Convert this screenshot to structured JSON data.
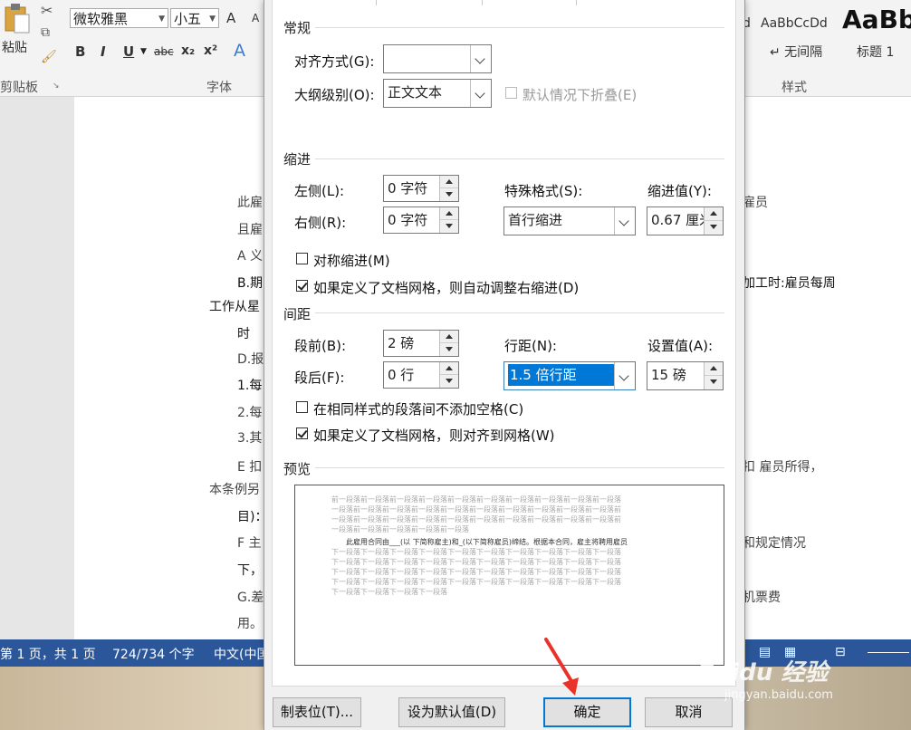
{
  "ribbon": {
    "paste_label": "粘贴",
    "font_name": "微软雅黑",
    "font_size": "小五",
    "grow_label": "A",
    "shrink_label": "A",
    "bold": "B",
    "italic": "I",
    "underline": "U",
    "strike": "abc",
    "subscript": "x₂",
    "superscript": "x²",
    "clipboard_label": "剪贴板",
    "font_group_label": "字体",
    "styles_group_label": "样式",
    "style_partial": "d",
    "style1_sample": "AaBbCcDd",
    "style1_name": "↵ 无间隔",
    "style2_sample": "AaBb",
    "style2_name": "标题 1"
  },
  "document": {
    "lines": [
      "此雇",
      "且雇",
      "A 义",
      "B.期",
      "工作从星",
      "时",
      "D.报",
      "1.每",
      "2.每",
      "3.其",
      "E 扣",
      "本条例另",
      "目)：",
      "F 主",
      "下，",
      "G.差",
      "用。"
    ],
    "right_lines": [
      "雇员",
      "加工时:雇员每周",
      "扣 雇员所得，",
      "和规定情况",
      "机票费"
    ]
  },
  "status": {
    "page": "第 1 页，共 1 页",
    "words": "724/734 个字",
    "lang": "中文(中国"
  },
  "dialog": {
    "general": {
      "title": "常规",
      "alignment_label": "对齐方式(G):",
      "alignment_value": "",
      "outline_label": "大纲级别(O):",
      "outline_value": "正文文本",
      "collapse_label": "默认情况下折叠(E)"
    },
    "indent": {
      "title": "缩进",
      "left_label": "左侧(L):",
      "left_value": "0 字符",
      "right_label": "右侧(R):",
      "right_value": "0 字符",
      "special_label": "特殊格式(S):",
      "special_value": "首行缩进",
      "by_label": "缩进值(Y):",
      "by_value": "0.67 厘米",
      "mirror_label": "对称缩进(M)",
      "mirror_checked": false,
      "auto_adjust_label": "如果定义了文档网格，则自动调整右缩进(D)",
      "auto_adjust_checked": true
    },
    "spacing": {
      "title": "间距",
      "before_label": "段前(B):",
      "before_value": "2 磅",
      "after_label": "段后(F):",
      "after_value": "0 行",
      "line_label": "行距(N):",
      "line_value": "1.5 倍行距",
      "at_label": "设置值(A):",
      "at_value": "15 磅",
      "no_space_label": "在相同样式的段落间不添加空格(C)",
      "no_space_checked": false,
      "snap_grid_label": "如果定义了文档网格，则对齐到网格(W)",
      "snap_grid_checked": true
    },
    "preview": {
      "title": "预览",
      "prev_lines": [
        "前一段落前一段落前一段落前一段落前一段落前一段落前一段落前一段落前一段落前一段落",
        "一段落前一段落前一段落前一段落前一段落前一段落前一段落前一段落前一段落前一段落前",
        "一段落前一段落前一段落前一段落前一段落前一段落前一段落前一段落前一段落前一段落前",
        "一段落前一段落前一段落前一段落前一段落"
      ],
      "current_line": "此雇用合同由___(以 下简称雇主)和_(以下简称雇员)缔结。根据本合同，雇主将聘用雇员",
      "next_lines": [
        "下一段落下一段落下一段落下一段落下一段落下一段落下一段落下一段落下一段落下一段落",
        "下一段落下一段落下一段落下一段落下一段落下一段落下一段落下一段落下一段落下一段落",
        "下一段落下一段落下一段落下一段落下一段落下一段落下一段落下一段落下一段落下一段落",
        "下一段落下一段落下一段落下一段落下一段落下一段落下一段落下一段落下一段落下一段落",
        "下一段落下一段落下一段落下一段落"
      ]
    },
    "buttons": {
      "tabs": "制表位(T)...",
      "set_default": "设为默认值(D)",
      "ok": "确定",
      "cancel": "取消"
    }
  },
  "watermark": {
    "logo": "Baidu 经验",
    "url": "jingyan.baidu.com"
  },
  "colors": {
    "accent": "#0078d7",
    "statusbar": "#2b579a",
    "arrow": "#e8322a"
  }
}
